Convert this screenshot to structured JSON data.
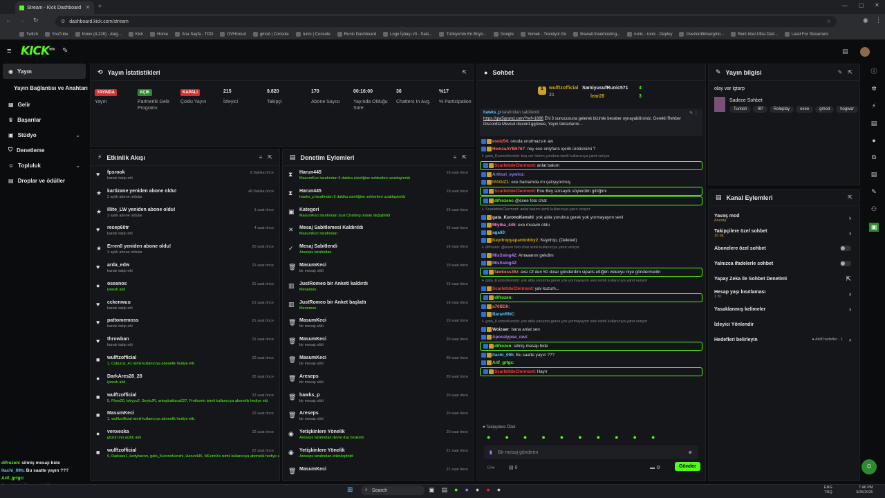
{
  "browser": {
    "tab_title": "Stream - Kick Dashboard",
    "url": "dashboard.kick.com/stream",
    "bookmarks": [
      "Twitch",
      "YouTube",
      "Inbox (4,226) - daig...",
      "Kick",
      "Home",
      "Ana Sayfa - TOD",
      "OVHcloud",
      "gmod | Console",
      "runic | Console",
      "Runic Dashboard",
      "Logo İşbaşı v3 - Sats...",
      "Türkiye'nin En Büyü...",
      "Google",
      "Yemek - Trendyol Go",
      "firewall.freakhosting...",
      "runic - runic - Deploy",
      "Overlordlikise/gmo...",
      "Rent Intel Ultra Ded...",
      "Lead For Streamers"
    ]
  },
  "app": {
    "logo": "KICK",
    "logo_sup": "BETA"
  },
  "sidebar": {
    "items": [
      "Yayın",
      "Yayın Bağlantısı ve Anahtarı",
      "Gelir",
      "Başarılar",
      "Stüdyo",
      "Denetleme",
      "Topluluk",
      "Droplar ve ödüller"
    ]
  },
  "stats": {
    "title": "Yayın İstatistikleri",
    "items": [
      {
        "value": "YAYINDA",
        "label": "Yayın",
        "color": "#d92c2c"
      },
      {
        "value": "AÇIK",
        "label": "Partnerlik Gelir Programı",
        "color": "#2e8a2e"
      },
      {
        "value": "KAPALI",
        "label": "Çoklu Yayın",
        "color": "#d92c2c"
      },
      {
        "value": "215",
        "label": "İzleyici"
      },
      {
        "value": "9.820",
        "label": "Takipçi"
      },
      {
        "value": "170",
        "label": "Abone Sayısı"
      },
      {
        "value": "00:16:00",
        "label": "Yayında Olduğu Süre"
      },
      {
        "value": "36",
        "label": "Chatters In Avg."
      },
      {
        "value": "%17",
        "label": "% Participation"
      }
    ]
  },
  "activity": {
    "title": "Etkinlik Akışı",
    "rows": [
      {
        "t": "fpsrook",
        "s": "kanalı takip etti",
        "tm": "8 dakika önce",
        "i": "♥"
      },
      {
        "t": "kartizane yeniden abone oldu!",
        "s": "2 aylık abone oldular",
        "tm": "48 dakika önce",
        "i": "★"
      },
      {
        "t": "Illite_LW yeniden abone oldu!",
        "s": "3 aylık abone oldular",
        "tm": "1 saat önce",
        "i": "★"
      },
      {
        "t": "recep60tr",
        "s": "kanalı takip etti",
        "tm": "4 saat önce",
        "i": "♥"
      },
      {
        "t": "Erren0 yeniden abone oldu!",
        "s": "3 aylık abone oldular",
        "tm": "20 saat önce",
        "i": "★"
      },
      {
        "t": "arda_edw",
        "s": "kanalı takip etti",
        "tm": "21 saat önce",
        "i": "♥"
      },
      {
        "t": "oseanos",
        "s": "iyeesh aldı",
        "tm": "21 saat önce",
        "i": "●"
      },
      {
        "t": "cckenwuu",
        "s": "kanalı takip etti",
        "tm": "21 saat önce",
        "i": "♥"
      },
      {
        "t": "pattomemoss",
        "s": "kanalı takip etti",
        "tm": "21 saat önce",
        "i": "♥"
      },
      {
        "t": "throwban",
        "s": "kanalı takip etti",
        "tm": "21 saat önce",
        "i": "♥"
      },
      {
        "t": "wulftzofficial",
        "s": "1, Cyburuz_41 isimli kullanıcıya abonelik hediye etti.",
        "tm": "22 saat önce",
        "i": "■"
      },
      {
        "t": "DarkAres28_28",
        "s": "iyeesh aldı",
        "tm": "22 saat önce",
        "i": "●"
      },
      {
        "t": "wulftzofficial",
        "s": "5, Floor20, tokyyo2, SeytoJR, antepbaklava027, Frothomir isimli kullanıcıya abonelik hediye etti.",
        "tm": "22 saat önce",
        "i": "■"
      },
      {
        "t": "MasumKeci",
        "s": "1, wulftzofficial isimli kullanıcıya abonelik hediye etti.",
        "tm": "22 saat önce",
        "i": "■"
      },
      {
        "t": "venxeska",
        "s": "gözün mü açıldı aldı",
        "tm": "22 saat önce",
        "i": "●"
      },
      {
        "t": "wulftzofficial",
        "s": "5, Darkass1, kedybacon, gata_KuronoKenshi, Harun445, MFerloXs isimli kullanıcıya abonelik hediye etti.",
        "tm": "22 saat önce",
        "i": "■"
      }
    ]
  },
  "mod": {
    "title": "Denetim Eylemleri",
    "rows": [
      {
        "t": "Harun445",
        "s": "MasumKeci tarafından 5 dakika süreliğine sohbetten uzaklaştırıldı",
        "tm": "19 saat önce",
        "i": "⧗"
      },
      {
        "t": "Harun445",
        "s": "hawks_p tarafından 5 dakika süreliğine sohbetten uzaklaştırıldı",
        "tm": "19 saat önce",
        "i": "⧗"
      },
      {
        "t": "Kategori",
        "s": "MasumKeci tarafından Just Chatting olarak değiştirildi",
        "tm": "19 saat önce",
        "i": "▣"
      },
      {
        "t": "Mesaj Sabitlemesi Kaldırıldı",
        "s": "MasumKeci tarafından",
        "tm": "19 saat önce",
        "i": "✕"
      },
      {
        "t": "Mesaj Sabitlendi",
        "s": "Areseps tarafından",
        "tm": "19 saat önce",
        "i": "✓"
      },
      {
        "t": "MasumKeci",
        "s": "bir mesajı sildi",
        "tm": "19 saat önce",
        "i": "🗑"
      },
      {
        "t": "JustRomeo bir Anketi kaldırdı",
        "s": "Menemen",
        "tm": "19 saat önce",
        "i": "▥"
      },
      {
        "t": "JustRomeo bir Anket başlattı",
        "s": "Menemen",
        "tm": "19 saat önce",
        "i": "▥"
      },
      {
        "t": "MasumKeci",
        "s": "bir mesajı sildi",
        "tm": "19 saat önce",
        "i": "🗑"
      },
      {
        "t": "MasumKeci",
        "s": "bir mesajı sildi",
        "tm": "20 saat önce",
        "i": "🗑"
      },
      {
        "t": "MasumKeci",
        "s": "bir mesajı sildi",
        "tm": "20 saat önce",
        "i": "🗑"
      },
      {
        "t": "Areseps",
        "s": "bir mesajı sildi",
        "tm": "20 saat önce",
        "i": "🗑"
      },
      {
        "t": "hawks_p",
        "s": "bir mesajı sildi",
        "tm": "20 saat önce",
        "i": "🗑"
      },
      {
        "t": "Areseps",
        "s": "bir mesajı sildi",
        "tm": "20 saat önce",
        "i": "🗑"
      },
      {
        "t": "Yetişkinlere Yönelik",
        "s": "Areseps tarafından devre dışı bırakıldı",
        "tm": "20 saat önce",
        "i": "◉"
      },
      {
        "t": "Yetişkinlere Yönelik",
        "s": "Areseps tarafından etkinleştirildi",
        "tm": "21 saat önce",
        "i": "◉"
      },
      {
        "t": "MasumKeci",
        "s": "",
        "tm": "21 saat önce",
        "i": "🗑"
      }
    ]
  },
  "chat": {
    "title": "Sohbet",
    "top": {
      "u1": "wulftzofficial",
      "n1": "21",
      "u2": "SamiyusufRunic571",
      "n2": "4",
      "u3": "lear28",
      "n3": "3"
    },
    "pinned": {
      "by": "hawks_p",
      "by_text": "tarafından sabitlendi",
      "link": "https://gta5grand.com/?ref=1686",
      "text": "EN 3 sunucusuna gelerek bizimle beraber oynayabilirsiniz. Gerekli Rehber Discordta Mevcut discord.gg/exee, Yayın tekrarlarını..."
    },
    "messages": [
      {
        "u": "esoiz54",
        "c": "#ff6b6b",
        "m": ": onuda unutmazsın aw"
      },
      {
        "u": "HemzaAYB6767",
        "c": "#ff6b6b",
        "m": ": ney exe onlyfans içerik üreticisimi ?"
      },
      {
        "rp": "gata_KuronoKenshi: boş ver özlem yorulma isimli kullanıcıya yanıt veriyor"
      },
      {
        "u": "ScarlettdeClermont",
        "c": "#ff3b3b",
        "m": ": anlat bakım",
        "hl": true
      },
      {
        "u": "Arthuri_eywinz",
        "c": "#8a7dff",
        "m": ":"
      },
      {
        "u": "IYAGIZ1",
        "c": "#c9a227",
        "m": ": exe hamamda mı çalışıyormuş"
      },
      {
        "u": "ScarlettdeClermont",
        "c": "#ff3b3b",
        "m": ": Exe Bey sorsaydı söylerdim gittiğimi",
        "hl": true
      },
      {
        "u": "difrozenc",
        "c": "#53fc18",
        "m": " @exee foto chat",
        "hl": true
      },
      {
        "rp": "ScarlettdeClermont: anlat bakım isimli kullanıcıya yanıt veriyor"
      },
      {
        "u": "gata_KuronoKenshi",
        "c": "#ddd",
        "m": ": yok abla yorulma gerek yok yormayayım seni"
      },
      {
        "u": "Miyiba_445",
        "c": "#ff8ad8",
        "m": ": exe muavin oldu"
      },
      {
        "u": "agali0",
        "c": "#5ec8ff",
        "m": ":"
      },
      {
        "u": "Keydropyapanbobby2",
        "c": "#c9a227",
        "m": ": Keydrop, (Deleted)"
      },
      {
        "rp": "difrozen: @exee foto chat isimli kullanıcıya yanıt veriyor"
      },
      {
        "u": "MisSsing42",
        "c": "#b57dff",
        "m": ": Amaaanın gekdim"
      },
      {
        "u": "MisSsing42",
        "c": "#b57dff",
        "m": ":"
      },
      {
        "u": "fawkess35z",
        "c": "#ff6b6b",
        "m": ": exe Of den 50 dolar gönderdim siparis ettiğim videoyu niye göndermedin",
        "hl": true
      },
      {
        "rp": "gata_KuronoKenshi: yok abla yorulma gerek yok yormayayım seni isimli kullanıcıya yanıt veriyor"
      },
      {
        "u": "ScarlettdeClermont",
        "c": "#ff3b3b",
        "m": ": yav kuzum..."
      },
      {
        "u": "difrozen",
        "c": "#53fc18",
        "m": ":",
        "hl": true
      },
      {
        "u": "a70BDit",
        "c": "#ff6b6b",
        "m": ":"
      },
      {
        "u": "BaranRNC",
        "c": "#5ec8ff",
        "m": ":"
      },
      {
        "rp": "gata_KuronoKenshi: yok abla yorulma gerek yok yormayayım seni isimli kullanıcıya yanıt veriyor"
      },
      {
        "u": "Woizaer",
        "c": "#ddd",
        "m": ": bana anlat sen"
      },
      {
        "u": "Apocalypse_ravi",
        "c": "#b57dff",
        "m": ":"
      },
      {
        "u": "difrozen",
        "c": "#53fc18",
        "m": ": silmiş mesajı bide",
        "hl": true
      },
      {
        "u": "itachi_09h",
        "c": "#5ec8ff",
        "m": ": Bu saatte yayın ???"
      },
      {
        "u": "Arif_grtgc",
        "c": "#53fc18",
        "m": ":"
      },
      {
        "u": "ScarlettdeClermont",
        "c": "#ff3b3b",
        "m": ": Hayır",
        "hl": true
      }
    ],
    "followers_label": "Takipçilere Özel",
    "input_placeholder": "Bir mesaj gönderin",
    "send": "Gönder",
    "count": "0"
  },
  "info": {
    "title": "Yayın bilgisi",
    "stream_title": "olay var lgtarp",
    "category": "Sadece Sohbet",
    "tags": [
      "Turkish",
      "RP",
      "Roleplay",
      "exee",
      "gmod",
      "hogwar"
    ]
  },
  "channel": {
    "title": "Kanal Eylemleri",
    "items": [
      {
        "t": "Yavaş mod",
        "sub": "Anında",
        "ctl": "›"
      },
      {
        "t": "Takipçilere özel sohbet",
        "sub": "10 dk.",
        "ctl": "›"
      },
      {
        "t": "Abonelere özel sohbet",
        "sub": "",
        "ctl": "toggle"
      },
      {
        "t": "Yalnızca ifadelerle sohbet",
        "sub": "",
        "ctl": "toggle"
      },
      {
        "t": "Yapay Zeka ile Sohbet Denetimi",
        "sub": "",
        "ctl": "⇱"
      },
      {
        "t": "Hesap yaşı kısıtlaması",
        "sub": "1 hf.",
        "ctl": "›"
      },
      {
        "t": "Yasaklanmış kelimeler",
        "sub": "",
        "ctl": "›"
      },
      {
        "t": "İzleyici Yönlendir",
        "sub": "",
        "ctl": ""
      },
      {
        "t": "Hedefleri belirleyin",
        "sub": "",
        "ctl": "›",
        "extra": "● Aktif hedefler - 1"
      }
    ]
  },
  "overlay": [
    {
      "u": "difrozen",
      "m": ": silmiş mesajı bide",
      "c": "#53fc18"
    },
    {
      "u": "Itachi_09h",
      "m": ": Bu saatte yayın ???",
      "c": "#5ec8ff"
    },
    {
      "u": "Arif_grtgc",
      "m": ":",
      "c": "#53fc18"
    },
    {
      "u": "ScarlettdeClermont",
      "m": ": Hayır",
      "c": "#ff3b3b"
    }
  ],
  "taskbar": {
    "search": "Search",
    "lang": "ENG",
    "lang2": "TRQ",
    "time": "7:46 PM",
    "date": "3/25/2026"
  }
}
